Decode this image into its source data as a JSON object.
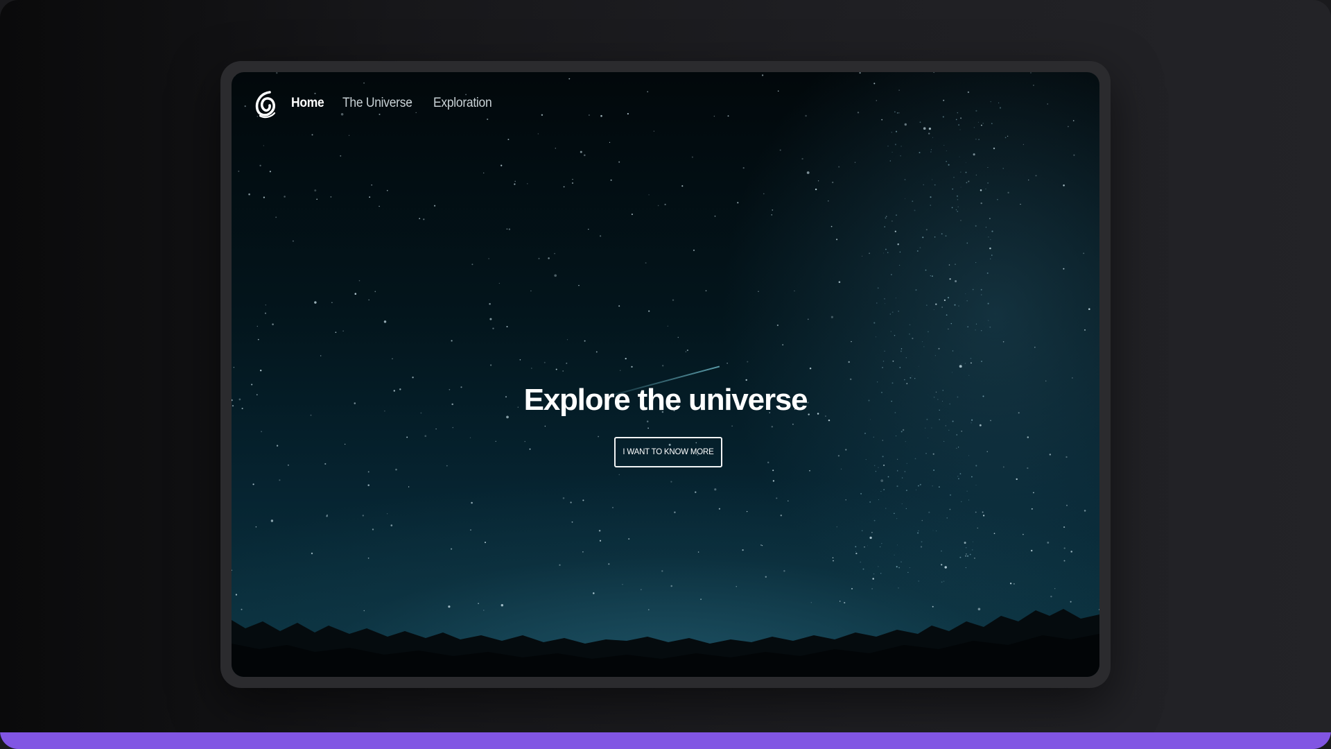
{
  "nav": {
    "logo_icon": "spiral-logo-icon",
    "links": [
      {
        "label": "Home",
        "active": true
      },
      {
        "label": "The Universe",
        "active": false
      },
      {
        "label": "Exploration",
        "active": false
      }
    ]
  },
  "hero": {
    "title": "Explore the universe",
    "cta_label": "I WANT TO KNOW MORE"
  },
  "colors": {
    "accent_bar": "#8155e3",
    "sky_top": "#02080b",
    "sky_bottom": "#0c3644",
    "text": "#ffffff"
  }
}
